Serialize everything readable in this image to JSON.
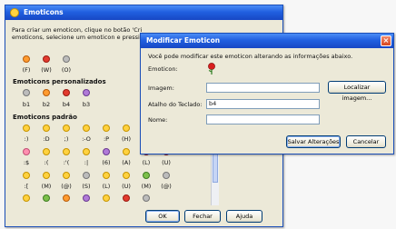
{
  "main": {
    "title": "Emoticons",
    "instructions_l1": "Para criar um emoticon, clique no botão 'Cri",
    "instructions_l2": "emoticons, selecione um emoticon e pressio",
    "top_row": {
      "labels": [
        "(F)",
        "(W)",
        "(O)"
      ]
    },
    "custom_heading": "Emoticons personalizados",
    "custom_labels": [
      "b1",
      "b2",
      "b4",
      "b3"
    ],
    "default_heading": "Emoticons padrão",
    "default_rows": [
      [
        ":)",
        ":D",
        ";)",
        ":-O",
        ":P",
        "(H)",
        ":@",
        ":S"
      ],
      [
        ":$",
        ":(",
        ":'(",
        ":|",
        "(6)",
        "(A)",
        "(L)",
        "(U)"
      ],
      [
        ":[",
        "(M)",
        "(@)",
        "(S)",
        "(L)",
        "(U)",
        "(M)",
        "(@)"
      ]
    ],
    "buttons": {
      "ok": "OK",
      "close": "Fechar",
      "help": "Ajuda"
    }
  },
  "dialog": {
    "title": "Modificar Emoticon",
    "description": "Você pode modificar este emoticon alterando as informações abaixo.",
    "emoticon_label": "Emoticon:",
    "image_label": "Imagem:",
    "shortcut_label": "Atalho do Teclado:",
    "shortcut_value": "b4",
    "name_label": "Nome:",
    "name_value": "",
    "locate_image_button": "Localizar imagem...",
    "save_button": "Salvar Alterações",
    "cancel_button": "Cancelar"
  },
  "colors": {
    "titlebar": "#2160e0",
    "window_bg": "#ece9d8"
  }
}
